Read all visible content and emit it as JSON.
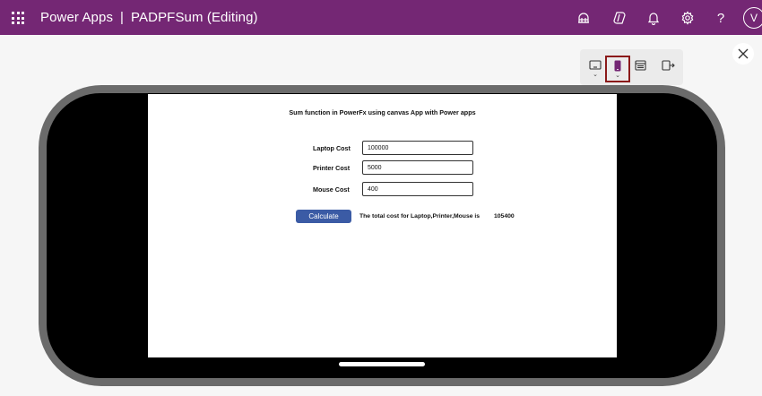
{
  "header": {
    "app_name": "Power Apps",
    "separator": "|",
    "doc_title": "PADPFSum (Editing)",
    "avatar_initial": "V",
    "background_color": "#742774"
  },
  "device_toolbar": {
    "buttons": [
      "tablet-layout-icon",
      "phone-layout-icon",
      "web-layout-icon",
      "custom-layout-icon"
    ],
    "selected": "phone-layout-icon",
    "chevron": "⌄"
  },
  "canvas": {
    "title": "Sum function in PowerFx using canvas App with Power apps",
    "fields": [
      {
        "label": "Laptop Cost",
        "value": "100000"
      },
      {
        "label": "Printer Cost",
        "value": "5000"
      },
      {
        "label": "Mouse Cost",
        "value": "400"
      }
    ],
    "calculate_label": "Calculate",
    "result_text": "The total cost for Laptop,Printer,Mouse is",
    "result_value": "105400",
    "button_color": "#3b5ba5"
  }
}
